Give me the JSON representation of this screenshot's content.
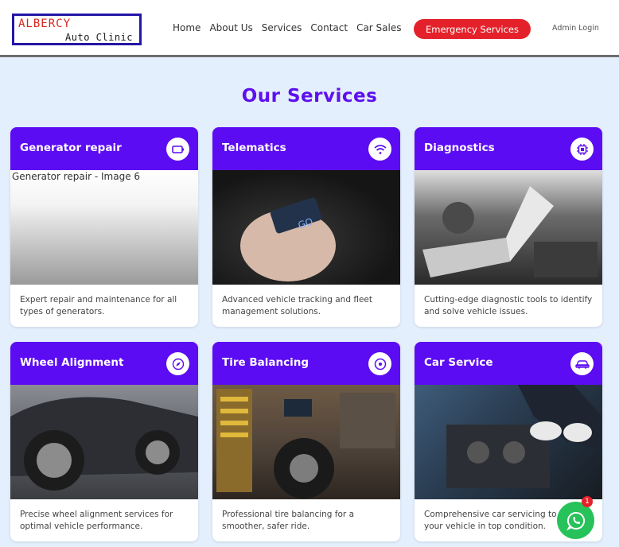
{
  "logo": {
    "line1": "ALBERCY",
    "line2": "Auto Clinic"
  },
  "nav": {
    "items": [
      "Home",
      "About Us",
      "Services",
      "Contact",
      "Car Sales"
    ],
    "emergency": "Emergency Services",
    "admin": "Admin Login"
  },
  "section_title": "Our Services",
  "services": [
    {
      "title": "Generator repair",
      "icon": "battery-icon",
      "image_alt": "Generator repair - Image 6",
      "desc": "Expert repair and maintenance for all types of generators."
    },
    {
      "title": "Telematics",
      "icon": "wifi-icon",
      "desc": "Advanced vehicle tracking and fleet management solutions."
    },
    {
      "title": "Diagnostics",
      "icon": "chip-icon",
      "desc": "Cutting-edge diagnostic tools to identify and solve vehicle issues."
    },
    {
      "title": "Wheel Alignment",
      "icon": "compass-icon",
      "desc": "Precise wheel alignment services for optimal vehicle performance."
    },
    {
      "title": "Tire Balancing",
      "icon": "circle-target-icon",
      "desc": "Professional tire balancing for a smoother, safer ride."
    },
    {
      "title": "Car Service",
      "icon": "car-icon",
      "desc": "Comprehensive car servicing to keep your vehicle in top condition."
    }
  ],
  "chat": {
    "badge": "1",
    "icon": "whatsapp-icon"
  },
  "colors": {
    "accent": "#5c0cf2",
    "heading": "#5e10ee",
    "emergency": "#e4212a",
    "whatsapp": "#28c25a",
    "page_bg": "#e4effd"
  }
}
